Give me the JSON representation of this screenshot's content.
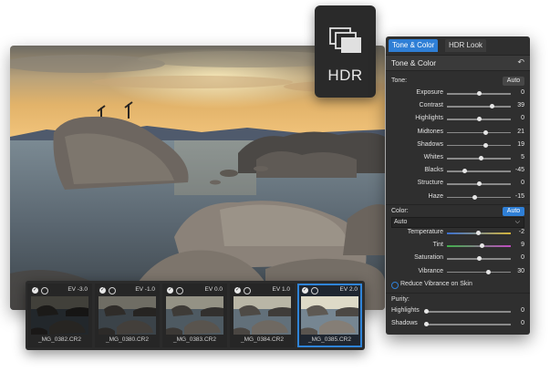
{
  "badge": {
    "label": "HDR",
    "icon": "stacked-frames-icon"
  },
  "panel": {
    "tabs": [
      {
        "label": "Tone & Color",
        "active": true
      },
      {
        "label": "HDR Look",
        "active": false
      }
    ],
    "header": {
      "title": "Tone & Color",
      "reset_icon": "undo-icon",
      "reset_glyph": "↶"
    },
    "tone": {
      "label": "Tone:",
      "auto_label": "Auto",
      "sliders": [
        {
          "label": "Exposure",
          "value": "0",
          "pos": 0.5
        },
        {
          "label": "Contrast",
          "value": "39",
          "pos": 0.7
        },
        {
          "label": "Highlights",
          "value": "0",
          "pos": 0.5
        },
        {
          "label": "Midtones",
          "value": "21",
          "pos": 0.61
        },
        {
          "label": "Shadows",
          "value": "19",
          "pos": 0.6
        },
        {
          "label": "Whites",
          "value": "5",
          "pos": 0.53
        },
        {
          "label": "Blacks",
          "value": "-45",
          "pos": 0.28
        },
        {
          "label": "Structure",
          "value": "0",
          "pos": 0.5
        },
        {
          "label": "Haze",
          "value": "-15",
          "pos": 0.43
        }
      ]
    },
    "color": {
      "label": "Color:",
      "auto_label": "Auto",
      "dropdown_value": "Auto",
      "sliders": [
        {
          "label": "Temperature",
          "value": "-2",
          "pos": 0.49,
          "gradient": "linear-gradient(90deg,#3a6fd0,#d4b33a)"
        },
        {
          "label": "Tint",
          "value": "9",
          "pos": 0.55,
          "gradient": "linear-gradient(90deg,#3fb04a,#c04ac0)"
        },
        {
          "label": "Saturation",
          "value": "0",
          "pos": 0.5,
          "gradient": ""
        },
        {
          "label": "Vibrance",
          "value": "30",
          "pos": 0.65,
          "gradient": ""
        }
      ],
      "checkbox_label": "Reduce Vibrance on Skin"
    },
    "purity": {
      "label": "Purity:",
      "sliders": [
        {
          "label": "Highlights",
          "value": "0",
          "pos": 0.0
        },
        {
          "label": "Shadows",
          "value": "0",
          "pos": 0.0
        }
      ]
    }
  },
  "filmstrip": {
    "thumbs": [
      {
        "ev": "EV -3.0",
        "filename": "_MG_0382.CR2",
        "selected": false,
        "brightness": 0.35
      },
      {
        "ev": "EV -1.0",
        "filename": "_MG_0380.CR2",
        "selected": false,
        "brightness": 0.6
      },
      {
        "ev": "EV 0.0",
        "filename": "_MG_0383.CR2",
        "selected": false,
        "brightness": 0.8
      },
      {
        "ev": "EV 1.0",
        "filename": "_MG_0384.CR2",
        "selected": false,
        "brightness": 1.0
      },
      {
        "ev": "EV 2.0",
        "filename": "_MG_0385.CR2",
        "selected": true,
        "brightness": 1.2
      }
    ]
  },
  "colors": {
    "accent": "#2f7fd6",
    "panel_bg": "#2f2f2f",
    "selection_border": "#2f84d8"
  }
}
